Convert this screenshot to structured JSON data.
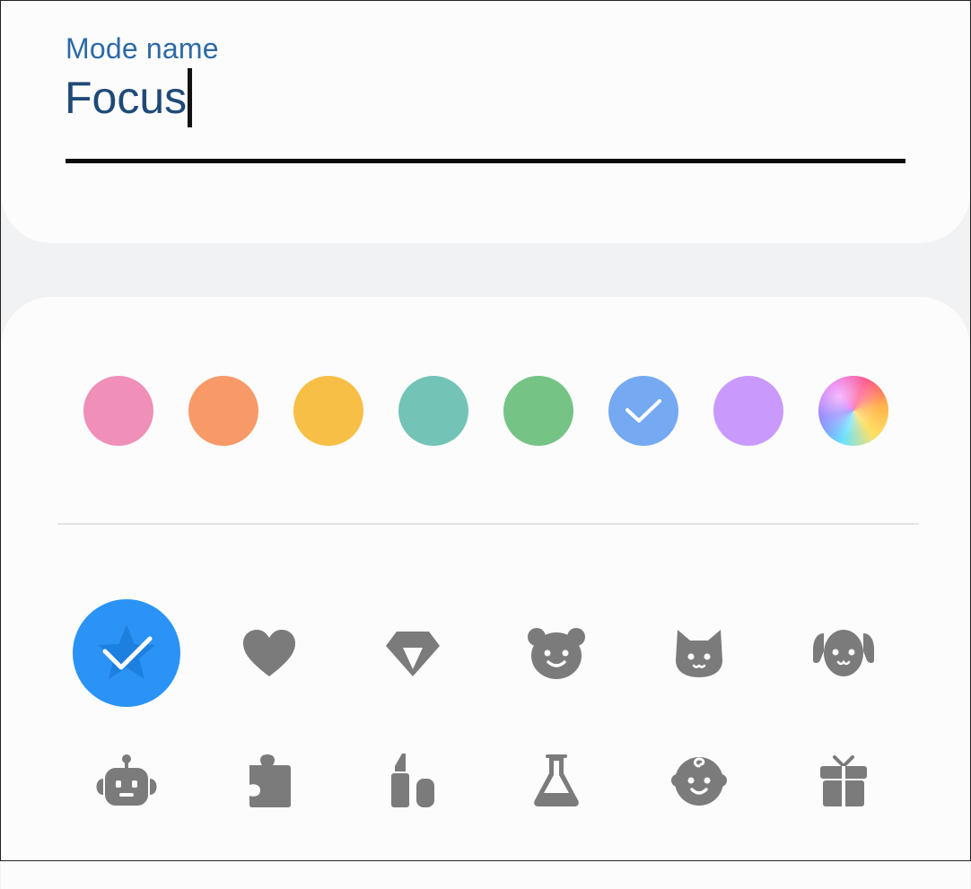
{
  "mode_name": {
    "label": "Mode name",
    "value": "Focus"
  },
  "colors": [
    {
      "name": "pink",
      "hex": "#f08fb8",
      "selected": false
    },
    {
      "name": "orange",
      "hex": "#f89a68",
      "selected": false
    },
    {
      "name": "yellow",
      "hex": "#f8bf47",
      "selected": false
    },
    {
      "name": "teal",
      "hex": "#73c4b6",
      "selected": false
    },
    {
      "name": "green",
      "hex": "#76c386",
      "selected": true,
      "selected_note": false
    },
    {
      "name": "blue",
      "hex": "#75a9f1",
      "selected": true
    },
    {
      "name": "purple",
      "hex": "#c99afb",
      "selected": false
    },
    {
      "name": "rainbow",
      "hex": "gradient",
      "selected": false
    }
  ],
  "icons": [
    {
      "name": "star-icon",
      "selected": true
    },
    {
      "name": "heart-icon",
      "selected": false
    },
    {
      "name": "diamond-icon",
      "selected": false
    },
    {
      "name": "bear-icon",
      "selected": false
    },
    {
      "name": "cat-icon",
      "selected": false
    },
    {
      "name": "dog-icon",
      "selected": false
    },
    {
      "name": "robot-icon",
      "selected": false
    },
    {
      "name": "puzzle-icon",
      "selected": false
    },
    {
      "name": "lipstick-icon",
      "selected": false
    },
    {
      "name": "flask-icon",
      "selected": false
    },
    {
      "name": "baby-icon",
      "selected": false
    },
    {
      "name": "gift-icon",
      "selected": false
    }
  ],
  "accent": "#2a93f5",
  "icon_color": "#7b7b7b"
}
